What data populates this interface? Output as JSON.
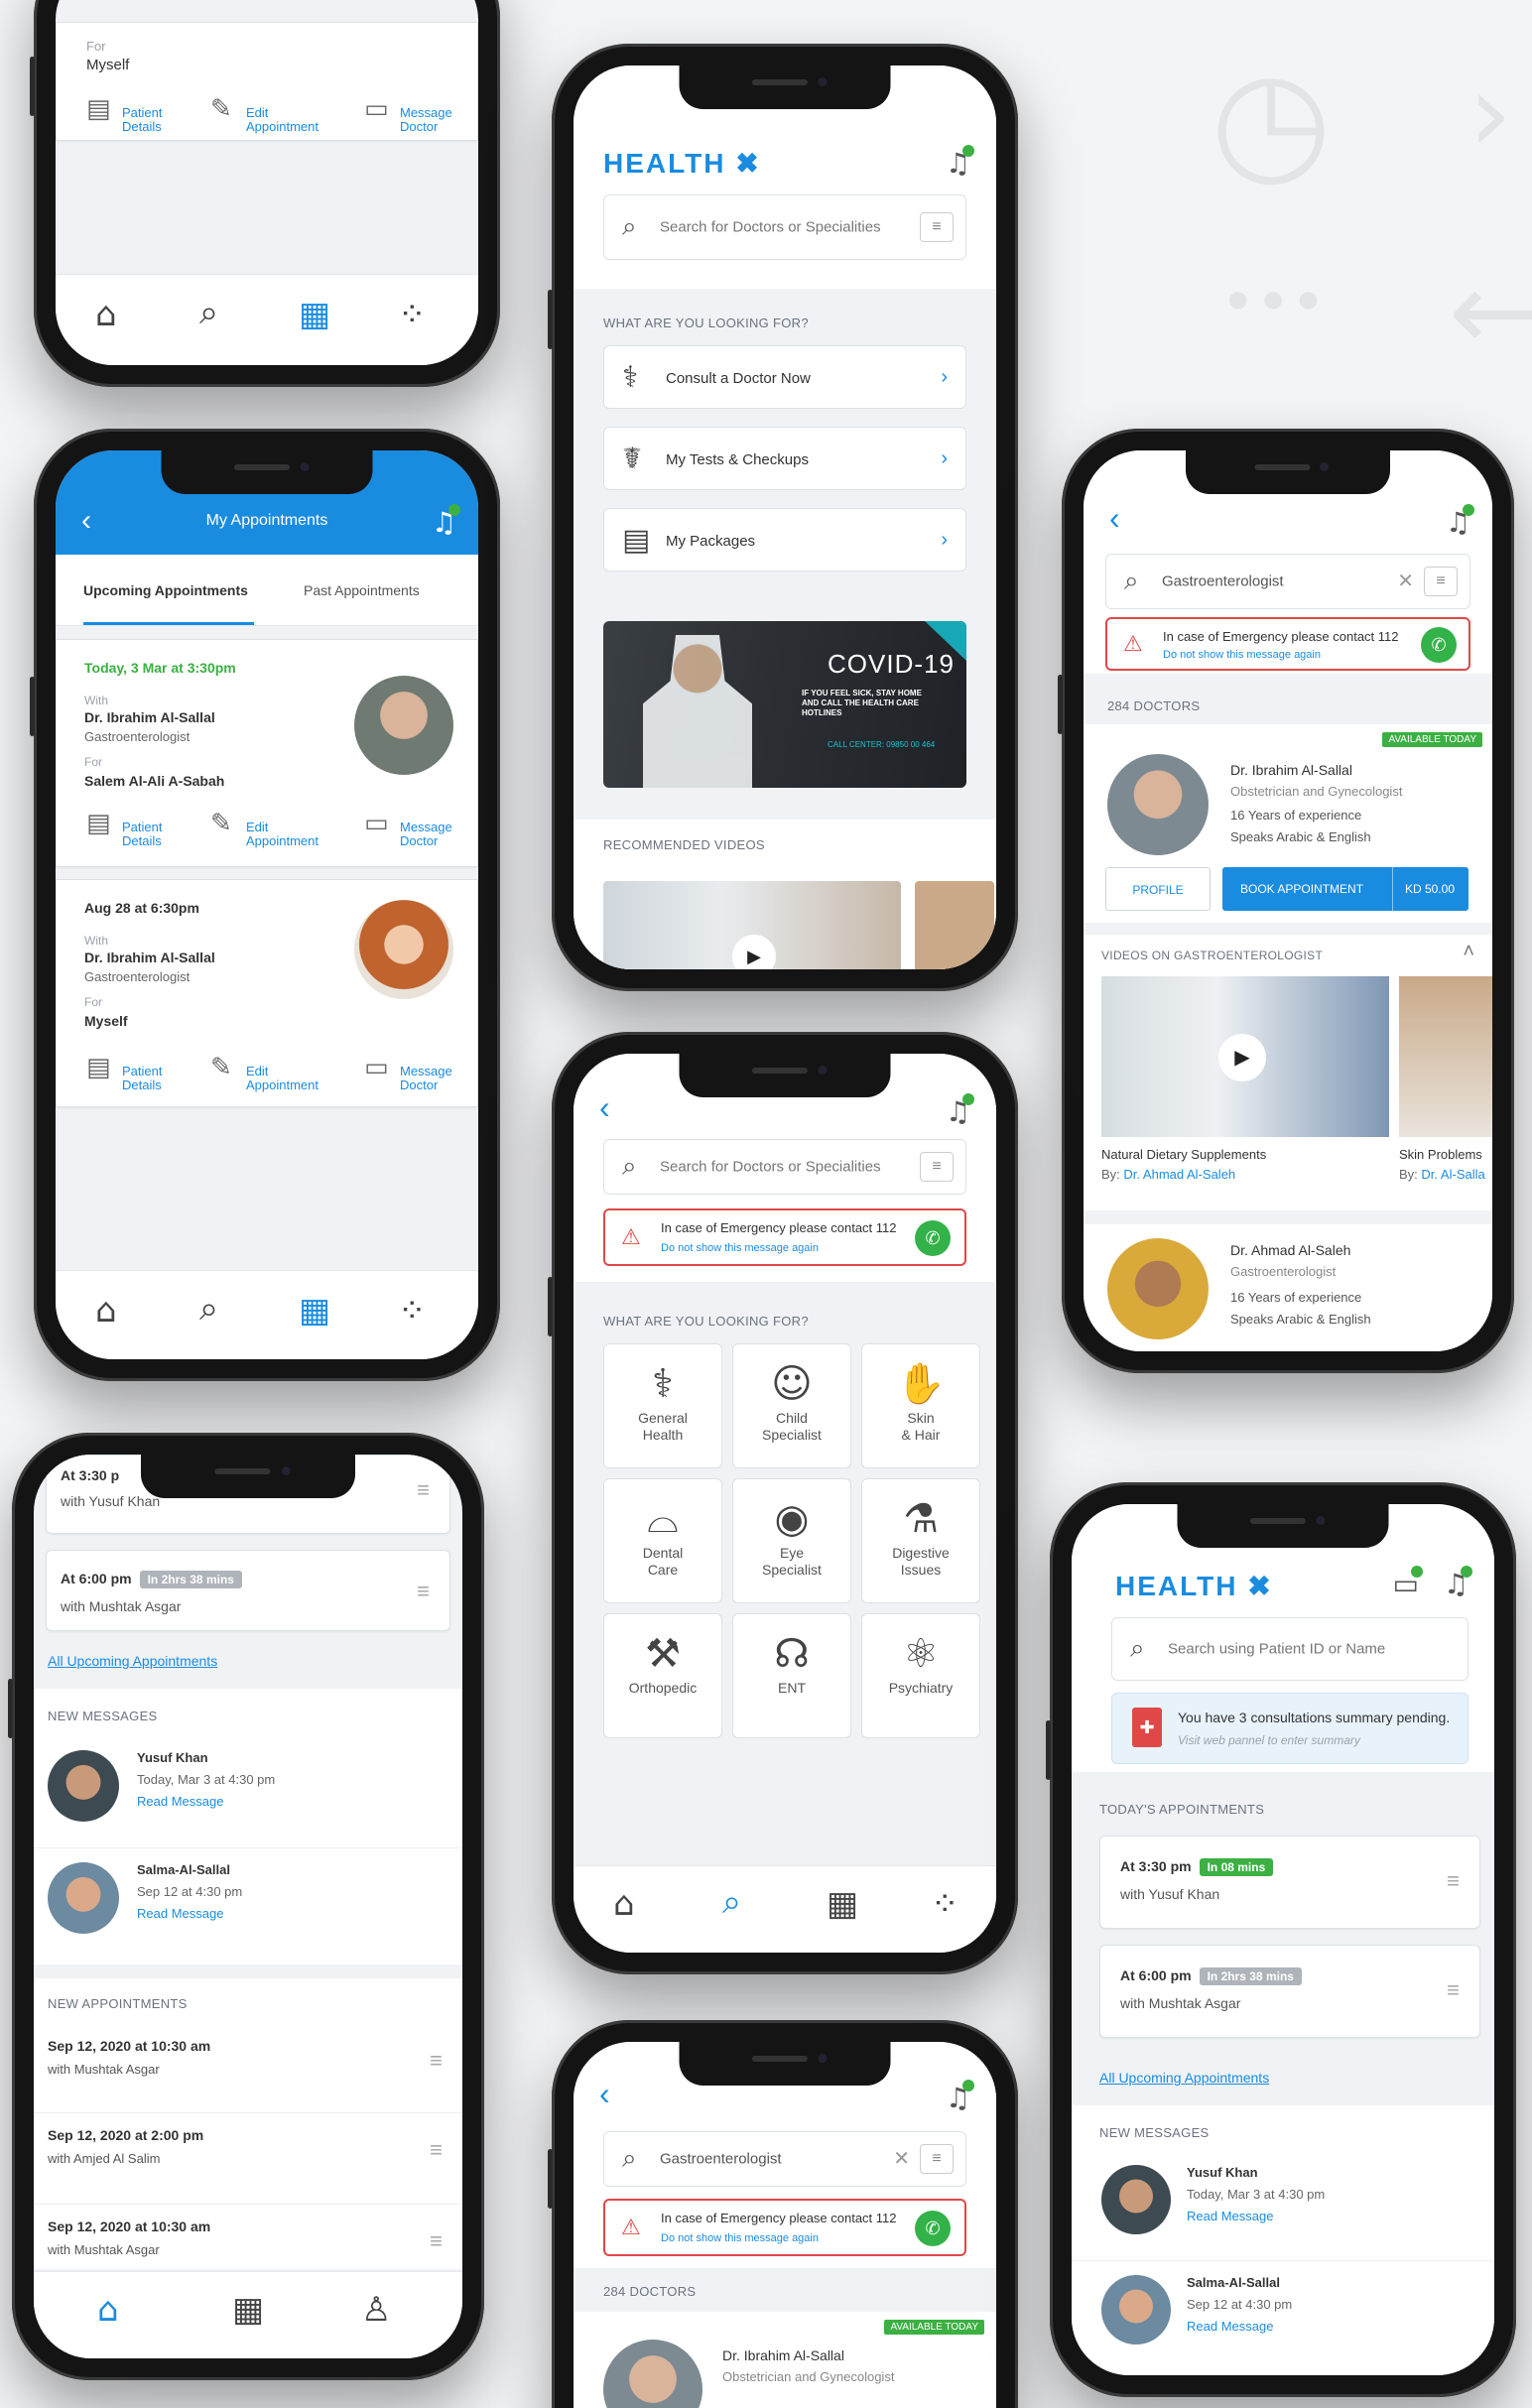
{
  "app": {
    "brand": "HEALTH",
    "brand_mark": "✖",
    "accent": "#1a8ce0",
    "success": "#3cb043",
    "danger": "#e04848"
  },
  "search": {
    "doctors_placeholder": "Search for Doctors or Specialities",
    "patient_placeholder": "Search using Patient ID or Name",
    "gastro_value": "Gastroenterologist"
  },
  "common": {
    "patient_details": [
      "Patient",
      "Details"
    ],
    "edit_appointment": [
      "Edit",
      "Appointment"
    ],
    "message_doctor": [
      "Message",
      "Doctor"
    ],
    "with": "With",
    "for": "For",
    "emergency_text": "In case of Emergency please contact 112",
    "emergency_hide": "Do not show this message again",
    "what_looking": "WHAT ARE YOU LOOKING FOR?",
    "doctors_count": "284 DOCTORS",
    "available_today": "AVAILABLE TODAY",
    "profile": "PROFILE",
    "book": "BOOK APPOINTMENT",
    "fee": "KD 50.00",
    "all_upcoming": "All Upcoming Appointments",
    "new_messages": "NEW MESSAGES",
    "new_appointments": "NEW APPOINTMENTS",
    "todays_appointments": "TODAY'S APPOINTMENTS",
    "read_message": "Read Message"
  },
  "p1": {
    "for_label": "For",
    "for_value": "Myself"
  },
  "p2": {
    "title": "My Appointments",
    "tab_upcoming": "Upcoming Appointments",
    "tab_past": "Past Appointments",
    "appt1": {
      "when": "Today, 3 Mar at 3:30pm",
      "doctor": "Dr. Ibrahim Al-Sallal",
      "spec": "Gastroenterologist",
      "for": "Salem Al-Ali A-Sabah"
    },
    "appt2": {
      "when": "Aug 28 at 6:30pm",
      "doctor": "Dr. Ibrahim Al-Sallal",
      "spec": "Gastroenterologist",
      "for": "Myself"
    }
  },
  "p3": {
    "items": [
      "Consult a Doctor Now",
      "My Tests & Checkups",
      "My Packages"
    ],
    "banner_title": "COVID-19",
    "banner_sub": "IF YOU FEEL SICK, STAY HOME AND CALL THE HEALTH CARE HOTLINES",
    "banner_call": "CALL CENTER: 09850 00 464",
    "recommended": "RECOMMENDED VIDEOS"
  },
  "p4": {
    "doctor": "Dr. Ibrahim Al-Sallal",
    "spec": "Obstetrician and Gynecologist",
    "exp": "16 Years of experience",
    "lang": "Speaks Arabic & English",
    "videos_hdr": "VIDEOS ON GASTROENTEROLOGIST",
    "video1_title": "Natural Dietary Supplements",
    "video1_by": "By:",
    "video1_author": "Dr. Ahmad Al-Saleh",
    "video2_title": "Skin Problems",
    "video2_by": "By:",
    "video2_author": "Dr. Al-Salla",
    "doc2": "Dr. Ahmad Al-Saleh",
    "doc2_spec": "Gastroenterologist",
    "doc2_exp": "16 Years of experience",
    "doc2_lang": "Speaks Arabic & English"
  },
  "p5": {
    "tiles": [
      [
        "General",
        "Health"
      ],
      [
        "Child",
        "Specialist"
      ],
      [
        "Skin",
        "& Hair"
      ],
      [
        "Dental",
        "Care"
      ],
      [
        "Eye",
        "Specialist"
      ],
      [
        "Digestive",
        "Issues"
      ],
      [
        "Orthopedic",
        ""
      ],
      [
        "ENT",
        ""
      ],
      [
        "Psychiatry",
        ""
      ]
    ]
  },
  "p6": {
    "top_time": "At 3:30 p",
    "top_with": "with Yusuf Khan",
    "appt_time": "At 6:00 pm",
    "appt_badge": "In 2hrs 38 mins",
    "appt_with": "with Mushtak Asgar",
    "msgs": [
      {
        "name": "Yusuf Khan",
        "time": "Today, Mar 3 at 4:30 pm"
      },
      {
        "name": "Salma-Al-Sallal",
        "time": "Sep 12 at 4:30 pm"
      }
    ],
    "new_appts": [
      {
        "time": "Sep 12, 2020 at 10:30 am",
        "with": "with Mushtak Asgar"
      },
      {
        "time": "Sep 12, 2020 at 2:00 pm",
        "with": "with Amjed Al Salim"
      },
      {
        "time": "Sep 12, 2020 at 10:30 am",
        "with": "with Mushtak Asgar"
      }
    ]
  },
  "p8": {
    "doctor": "Dr. Ibrahim Al-Sallal",
    "spec": "Obstetrician and Gynecologist"
  },
  "p9": {
    "pending": "You have 3 consultations summary pending.",
    "pending_sub": "Visit web pannel to enter summary",
    "appts": [
      {
        "time": "At 3:30 pm",
        "badge": "In 08 mins",
        "with": "with Yusuf Khan"
      },
      {
        "time": "At 6:00 pm",
        "badge": "In 2hrs 38 mins",
        "with": "with Mushtak Asgar"
      }
    ],
    "msgs": [
      {
        "name": "Yusuf Khan",
        "time": "Today, Mar 3 at 4:30 pm"
      },
      {
        "name": "Salma-Al-Sallal",
        "time": "Sep 12 at 4:30 pm"
      }
    ]
  }
}
